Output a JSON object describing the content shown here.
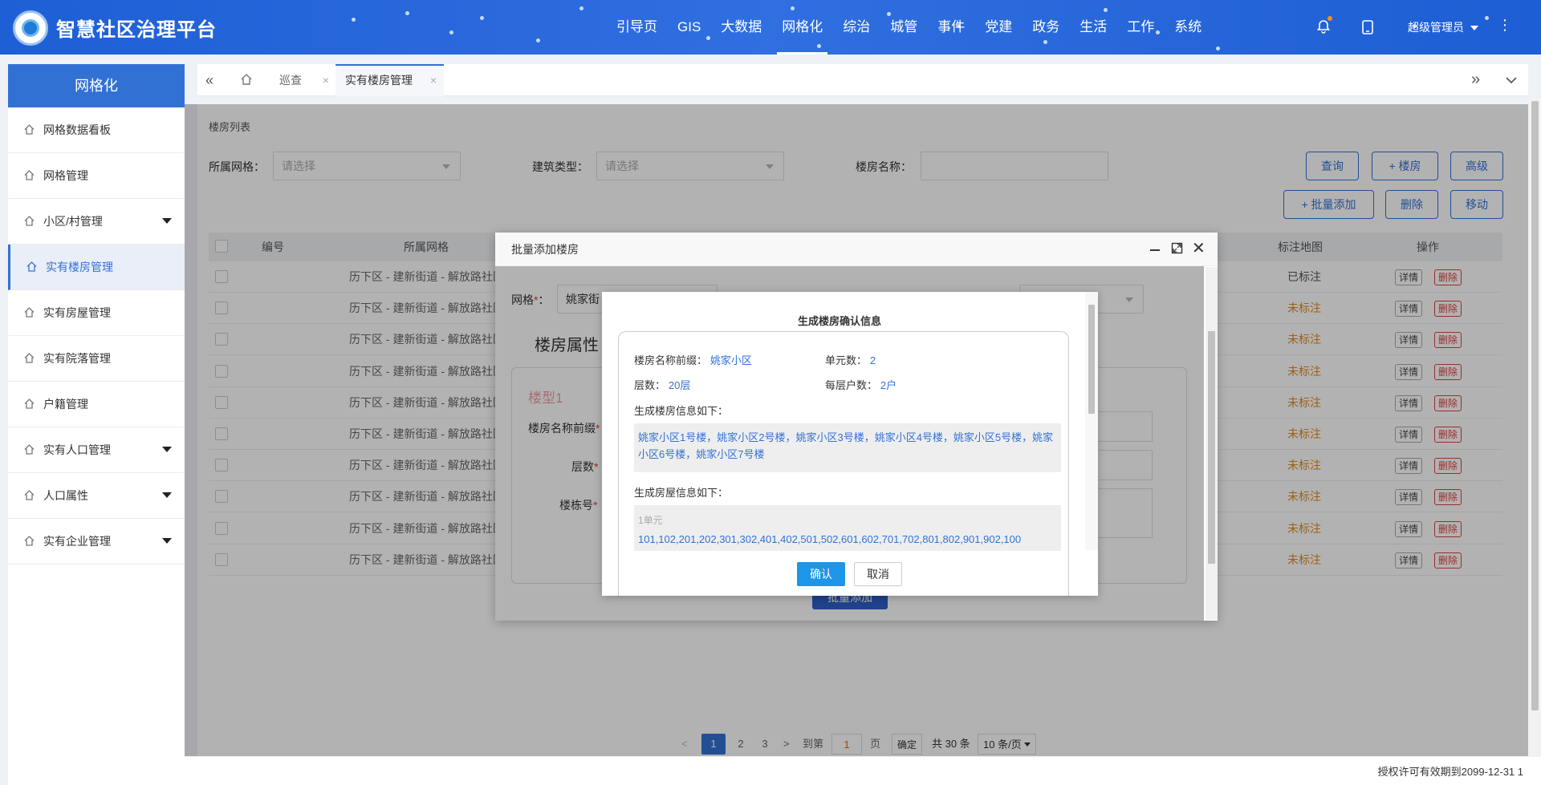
{
  "header": {
    "app_title": "智慧社区治理平台",
    "nav": [
      "引导页",
      "GIS",
      "大数据",
      "网格化",
      "综治",
      "城管",
      "事件",
      "党建",
      "政务",
      "生活",
      "工作",
      "系统"
    ],
    "active_nav": "网格化",
    "user": "超级管理员",
    "icons": [
      "bell-icon",
      "tablet-icon",
      "more-icon"
    ]
  },
  "sidebar": {
    "title": "网格化",
    "items": [
      {
        "label": "网格数据看板",
        "caret": false
      },
      {
        "label": "网格管理",
        "caret": false
      },
      {
        "label": "小区/村管理",
        "caret": true
      },
      {
        "label": "实有楼房管理",
        "caret": false,
        "active": true
      },
      {
        "label": "实有房屋管理",
        "caret": false
      },
      {
        "label": "实有院落管理",
        "caret": false
      },
      {
        "label": "户籍管理",
        "caret": false
      },
      {
        "label": "实有人口管理",
        "caret": true
      },
      {
        "label": "人口属性",
        "caret": true
      },
      {
        "label": "实有企业管理",
        "caret": true
      }
    ]
  },
  "tabs": {
    "items": [
      "巡查",
      "实有楼房管理"
    ],
    "close_glyph": "×"
  },
  "page": {
    "section_title": "楼房列表",
    "filters": {
      "grid_label": "所属网格：",
      "grid_placeholder": "请选择",
      "type_label": "建筑类型：",
      "type_placeholder": "请选择",
      "name_label": "楼房名称："
    },
    "buttons": {
      "query": "查询",
      "add": "+ 楼房",
      "advanced": "高级",
      "batch_add": "+ 批量添加",
      "delete": "删除",
      "move": "移动"
    },
    "table": {
      "headers": {
        "id": "编号",
        "grid": "所属网格",
        "map": "标注地图",
        "ops": "操作"
      },
      "rows": [
        {
          "grid": "历下区 - 建新街道 - 解放路社区",
          "map": "已标注",
          "marked": true
        },
        {
          "grid": "历下区 - 建新街道 - 解放路社区",
          "map": "未标注",
          "marked": false
        },
        {
          "grid": "历下区 - 建新街道 - 解放路社区",
          "map": "未标注",
          "marked": false
        },
        {
          "grid": "历下区 - 建新街道 - 解放路社区",
          "map": "未标注",
          "marked": false
        },
        {
          "grid": "历下区 - 建新街道 - 解放路社区",
          "map": "未标注",
          "marked": false
        },
        {
          "grid": "历下区 - 建新街道 - 解放路社区",
          "map": "未标注",
          "marked": false
        },
        {
          "grid": "历下区 - 建新街道 - 解放路社区",
          "map": "未标注",
          "marked": false
        },
        {
          "grid": "历下区 - 建新街道 - 解放路社区",
          "map": "未标注",
          "marked": false
        },
        {
          "grid": "历下区 - 建新街道 - 解放路社区",
          "map": "未标注",
          "marked": false
        },
        {
          "grid": "历下区 - 建新街道 - 解放路社区",
          "map": "未标注",
          "marked": false
        }
      ],
      "detail": "详情",
      "remove": "删除"
    },
    "pagination": {
      "prev": "<",
      "pages": [
        "1",
        "2",
        "3"
      ],
      "next": ">",
      "goto": "到第",
      "current": "1",
      "page_unit": "页",
      "confirm": "确定",
      "total": "共 30 条",
      "size": "10 条/页"
    }
  },
  "footer": {
    "license": "授权许可有效期到2099-12-31 1"
  },
  "dialog_outer": {
    "title": "批量添加楼房",
    "grid_label": "网格",
    "grid_value": "姚家街",
    "section": "楼房属性",
    "type_label": "楼型1",
    "fields": [
      "楼房名称前缀",
      "层数",
      "楼栋号"
    ],
    "submit": "批量添加"
  },
  "dialog_inner": {
    "title": "生成楼房确认信息",
    "prefix_label": "楼房名称前缀：",
    "prefix_value": "姚家小区",
    "units_label": "单元数：",
    "units_value": "2",
    "floors_label": "层数：",
    "floors_value": "20层",
    "per_floor_label": "每层户数：",
    "per_floor_value": "2户",
    "buildings_label": "生成楼房信息如下：",
    "buildings_text": "姚家小区1号楼，姚家小区2号楼，姚家小区3号楼，姚家小区4号楼，姚家小区5号楼，姚家小区6号楼，姚家小区7号楼",
    "rooms_label": "生成房屋信息如下：",
    "rooms_unit": "1单元",
    "rooms_text": "101,102,201,202,301,302,401,402,501,502,601,602,701,702,801,802,901,902,100",
    "confirm": "确认",
    "cancel": "取消"
  }
}
